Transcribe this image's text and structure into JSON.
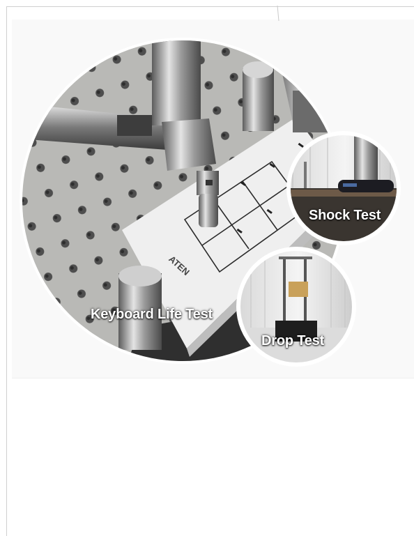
{
  "labels": {
    "main": "Keyboard Life Test",
    "shock": "Shock Test",
    "drop": "Drop Test",
    "brand": "ATEN"
  },
  "colors": {
    "background": "#ffffff",
    "panel": "#f9f9f9",
    "metal_plate": "#b7b7b4",
    "keyboard": "#eeeeee"
  }
}
